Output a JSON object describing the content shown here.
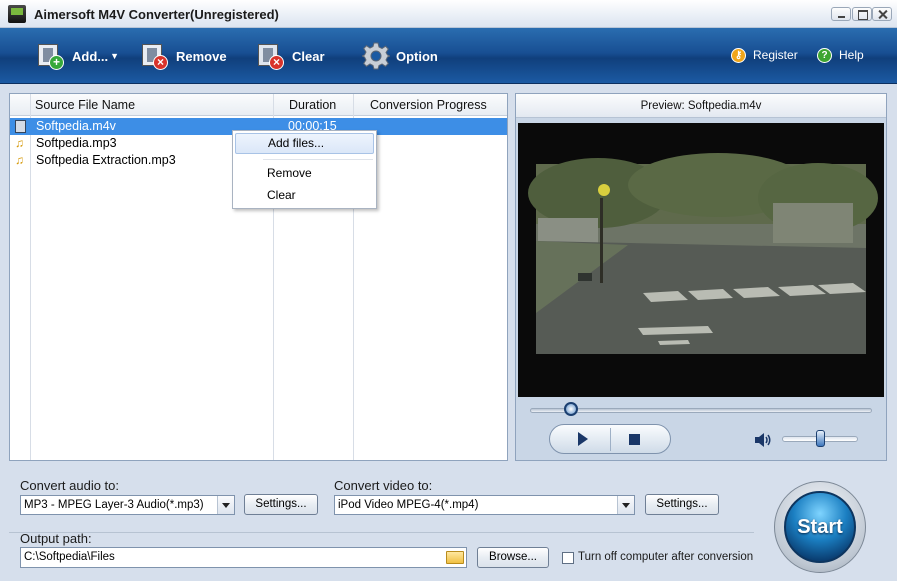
{
  "window": {
    "title": "Aimersoft M4V Converter(Unregistered)"
  },
  "toolbar": {
    "add_label": "Add...",
    "remove_label": "Remove",
    "clear_label": "Clear",
    "option_label": "Option",
    "register_label": "Register",
    "help_label": "Help"
  },
  "file_list": {
    "headers": [
      "Source File Name",
      "Duration",
      "Conversion Progress"
    ],
    "rows": [
      {
        "name": "Softpedia.m4v",
        "duration": "00:00:15",
        "icon": "video-file-icon",
        "selected": true
      },
      {
        "name": "Softpedia.mp3",
        "duration": "",
        "icon": "audio-file-icon",
        "selected": false
      },
      {
        "name": "Softpedia Extraction.mp3",
        "duration": "",
        "icon": "audio-file-icon",
        "selected": false
      }
    ]
  },
  "context_menu": {
    "items": [
      "Add files...",
      "Remove",
      "Clear"
    ],
    "highlighted": "Add files..."
  },
  "preview": {
    "title": "Preview: Softpedia.m4v",
    "seek_position": 0.12,
    "volume_level": 0.5
  },
  "convert": {
    "audio_label": "Convert audio to:",
    "audio_value": "MP3 - MPEG Layer-3 Audio(*.mp3)",
    "video_label": "Convert video to:",
    "video_value": "iPod Video MPEG-4(*.mp4)",
    "settings_label": "Settings...",
    "output_label": "Output path:",
    "output_value": "C:\\Softpedia\\Files",
    "browse_label": "Browse...",
    "shutdown_label": "Turn off computer after conversion",
    "shutdown_checked": false,
    "start_label": "Start"
  },
  "colors": {
    "toolbar": "#184f93",
    "selection": "#3d8ee6",
    "background": "#d6dfec"
  }
}
